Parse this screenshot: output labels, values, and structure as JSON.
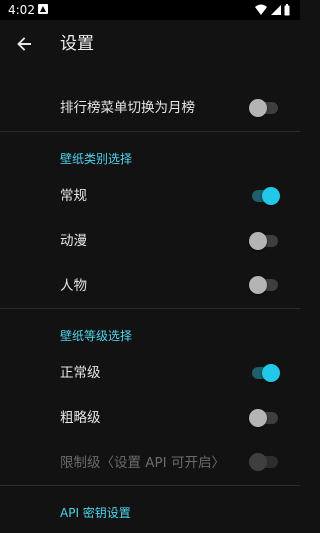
{
  "status_bar": {
    "time": "4:02",
    "icons": [
      "notification-icon",
      "wifi-icon",
      "signal-icon",
      "battery-icon"
    ]
  },
  "app_bar": {
    "title": "设置",
    "back_icon": "back-arrow-icon"
  },
  "settings": {
    "monthly_ranking": {
      "label": "排行榜菜单切换为月榜",
      "enabled": false
    },
    "wallpaper_category": {
      "header": "壁纸类别选择",
      "items": [
        {
          "label": "常规",
          "enabled": true
        },
        {
          "label": "动漫",
          "enabled": false
        },
        {
          "label": "人物",
          "enabled": false
        }
      ]
    },
    "wallpaper_level": {
      "header": "壁纸等级选择",
      "items": [
        {
          "label": "正常级",
          "enabled": true
        },
        {
          "label": "粗略级",
          "enabled": false
        },
        {
          "label": "限制级〈设置 API 可开启〉",
          "enabled": false,
          "disabled": true
        }
      ]
    },
    "api_key": {
      "header": "API 密钥设置"
    }
  },
  "colors": {
    "background": "#121212",
    "accent": "#22c8e8",
    "section_header": "#4fd3ec",
    "disabled_text": "#6b6b6b"
  }
}
